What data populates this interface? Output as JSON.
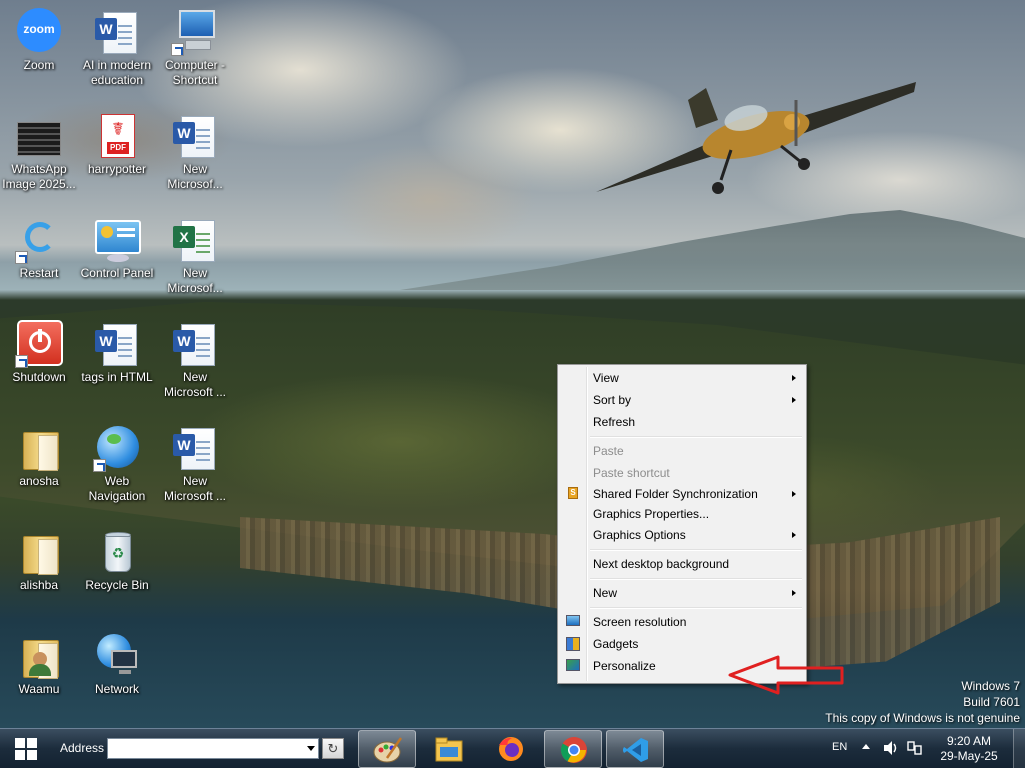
{
  "desktop": {
    "icons": [
      {
        "label": "Zoom",
        "icon": "zoom-icon"
      },
      {
        "label": "AI in modern\neducation",
        "icon": "word-document-icon"
      },
      {
        "label": "Computer -\nShortcut",
        "icon": "computer-icon"
      },
      {
        "label": "WhatsApp\nImage 2025...",
        "icon": "image-file-icon"
      },
      {
        "label": "harrypotter",
        "icon": "pdf-icon"
      },
      {
        "label": "New\nMicrosof...",
        "icon": "word-document-icon"
      },
      {
        "label": "Restart",
        "icon": "restart-icon"
      },
      {
        "label": "Control Panel",
        "icon": "control-panel-icon"
      },
      {
        "label": "New\nMicrosof...",
        "icon": "excel-document-icon"
      },
      {
        "label": "Shutdown",
        "icon": "shutdown-icon"
      },
      {
        "label": "tags in HTML",
        "icon": "word-document-icon"
      },
      {
        "label": "New\nMicrosoft ...",
        "icon": "word-document-icon"
      },
      {
        "label": "anosha",
        "icon": "folder-icon"
      },
      {
        "label": "Web\nNavigation",
        "icon": "globe-icon"
      },
      {
        "label": "New\nMicrosoft ...",
        "icon": "word-document-icon"
      },
      {
        "label": "alishba",
        "icon": "folder-icon"
      },
      {
        "label": "Recycle Bin",
        "icon": "recycle-bin-icon"
      },
      {
        "label": "Waamu",
        "icon": "user-folder-icon"
      },
      {
        "label": "Network",
        "icon": "network-icon"
      }
    ]
  },
  "context_menu": {
    "items": [
      {
        "label": "View",
        "submenu": true,
        "disabled": false
      },
      {
        "label": "Sort by",
        "submenu": true,
        "disabled": false
      },
      {
        "label": "Refresh",
        "submenu": false,
        "disabled": false
      },
      {
        "label": "Paste",
        "submenu": false,
        "disabled": true
      },
      {
        "label": "Paste shortcut",
        "submenu": false,
        "disabled": true
      },
      {
        "label": "Shared Folder Synchronization",
        "submenu": true,
        "disabled": false,
        "icon": "sync-icon"
      },
      {
        "label": "Graphics Properties...",
        "submenu": false,
        "disabled": false
      },
      {
        "label": "Graphics Options",
        "submenu": true,
        "disabled": false
      },
      {
        "label": "Next desktop background",
        "submenu": false,
        "disabled": false
      },
      {
        "label": "New",
        "submenu": true,
        "disabled": false
      },
      {
        "label": "Screen resolution",
        "submenu": false,
        "disabled": false,
        "icon": "monitor-icon"
      },
      {
        "label": "Gadgets",
        "submenu": false,
        "disabled": false,
        "icon": "gadgets-icon"
      },
      {
        "label": "Personalize",
        "submenu": false,
        "disabled": false,
        "icon": "personalize-icon"
      }
    ]
  },
  "watermark": {
    "line1": "Windows 7",
    "line2": "Build 7601",
    "line3": "This copy of Windows is not genuine"
  },
  "taskbar": {
    "address_label": "Address",
    "address_value": "",
    "pinned": [
      {
        "name": "paint",
        "icon": "paint-icon",
        "active": true
      },
      {
        "name": "file-explorer",
        "icon": "folder-icon",
        "active": false
      },
      {
        "name": "firefox",
        "icon": "firefox-icon",
        "active": false
      },
      {
        "name": "chrome",
        "icon": "chrome-icon",
        "active": true
      },
      {
        "name": "vscode",
        "icon": "vscode-icon",
        "active": true
      }
    ],
    "language": "EN",
    "time": "9:20 AM",
    "date": "29-May-25"
  },
  "colors": {
    "annotation_arrow": "#e02020",
    "taskbar": "#1c2c3c"
  }
}
